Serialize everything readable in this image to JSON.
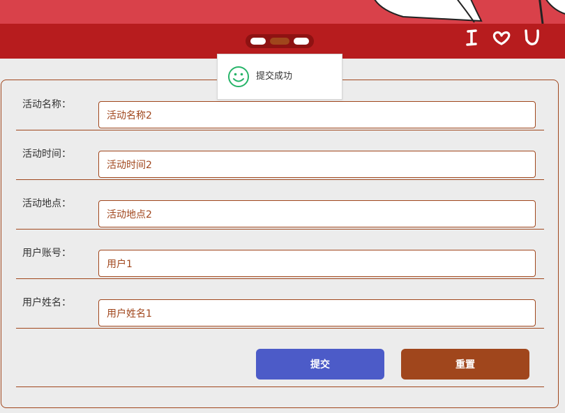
{
  "banner": {
    "slogan_icons": [
      "letter-i-icon",
      "heart-icon",
      "letter-u-icon"
    ],
    "carousel_active_index": 1,
    "colors": {
      "top": "#d9414a",
      "bar": "#b71c1e",
      "dots_track": "#8e1212",
      "dot_active": "#a0461c"
    }
  },
  "toast": {
    "icon": "smile-icon",
    "icon_color": "#27b469",
    "message": "提交成功"
  },
  "form": {
    "fields": [
      {
        "label": "活动名称：",
        "value": "活动名称2"
      },
      {
        "label": "活动时间：",
        "value": "活动时间2"
      },
      {
        "label": "活动地点：",
        "value": "活动地点2"
      },
      {
        "label": "用户账号：",
        "value": "用户1"
      },
      {
        "label": "用户姓名：",
        "value": "用户姓名1"
      }
    ],
    "submit_label": "提交",
    "reset_label": "重置",
    "accent_color": "#a0461c",
    "submit_color": "#4c5bc8"
  }
}
